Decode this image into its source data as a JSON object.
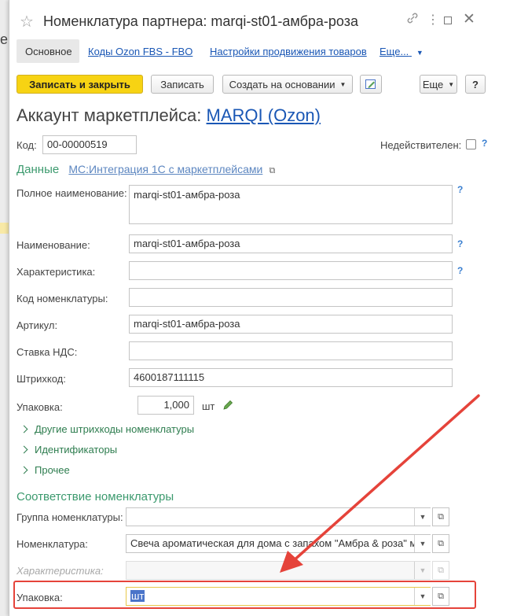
{
  "background": {
    "fragment_text": "ер"
  },
  "window": {
    "title": "Номенклатура партнера: marqi-st01-амбра-роза",
    "icons": [
      "star-icon",
      "link-icon",
      "more-icon",
      "maximize-icon",
      "close-icon"
    ]
  },
  "tabs": {
    "main": "Основное",
    "codes": "Коды Ozon FBS - FBO",
    "promo": "Настройки продвижения товаров",
    "more": "Еще..."
  },
  "toolbar": {
    "save_close": "Записать и закрыть",
    "save": "Записать",
    "create_based": "Создать на основании",
    "more": "Еще",
    "help": "?"
  },
  "account": {
    "label": "Аккаунт маркетплейса:",
    "value": "MARQI (Ozon)"
  },
  "code": {
    "label": "Код:",
    "value": "00-00000519"
  },
  "inactive": {
    "label": "Недействителен:"
  },
  "data_section": {
    "title": "Данные",
    "link": "MC:Интеграция 1С с маркетплейсами"
  },
  "fields": {
    "full_name": {
      "label": "Полное наименование:",
      "value": "marqi-st01-амбра-роза"
    },
    "name": {
      "label": "Наименование:",
      "value": "marqi-st01-амбра-роза"
    },
    "characteristic": {
      "label": "Характеристика:",
      "value": ""
    },
    "item_code": {
      "label": "Код номенклатуры:",
      "value": ""
    },
    "article": {
      "label": "Артикул:",
      "value": "marqi-st01-амбра-роза"
    },
    "vat": {
      "label": "Ставка НДС:",
      "value": ""
    },
    "barcode": {
      "label": "Штрихкод:",
      "value": "4600187111115"
    },
    "package": {
      "label": "Упаковка:",
      "value": "1,000",
      "unit": "шт"
    }
  },
  "expanders": {
    "other_barcodes": "Другие штрихкоды номенклатуры",
    "identifiers": "Идентификаторы",
    "other": "Прочее"
  },
  "mapping": {
    "title": "Соответствие номенклатуры",
    "group": {
      "label": "Группа номенклатуры:",
      "value": ""
    },
    "nomenclature": {
      "label": "Номенклатура:",
      "value": "Свеча ароматическая для дома с запахом \"Амбра & роза\" м"
    },
    "characteristic": {
      "label": "Характеристика:",
      "value": ""
    },
    "package": {
      "label": "Упаковка:",
      "value": "шт"
    }
  },
  "colors": {
    "accent_yellow": "#f7d313",
    "link_blue": "#1a57b5",
    "section_green": "#3c9a6e",
    "highlight_red": "#e5433a"
  }
}
